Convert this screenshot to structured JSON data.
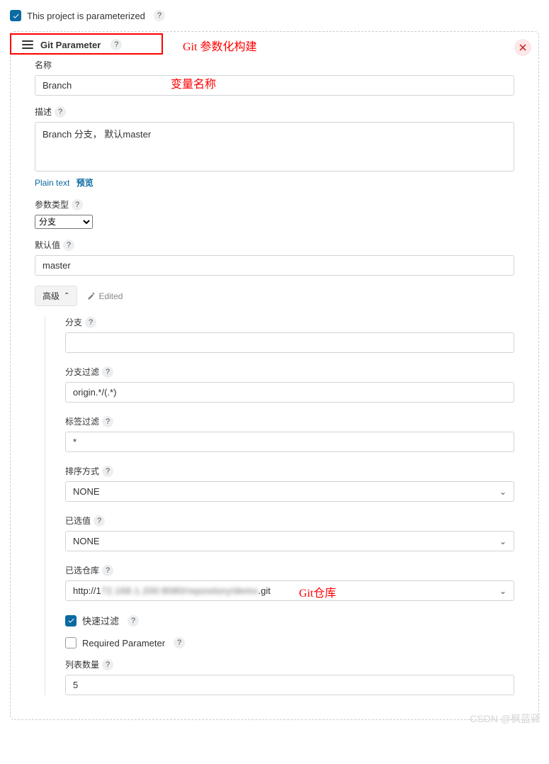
{
  "topCheckbox": {
    "label": "This project is parameterized",
    "checked": true
  },
  "panel": {
    "title": "Git Parameter",
    "annotations": {
      "header": "Git 参数化构建",
      "nameField": "变量名称",
      "repoField": "Git仓库"
    }
  },
  "fields": {
    "name": {
      "label": "名称",
      "value": "Branch"
    },
    "description": {
      "label": "描述",
      "value": "Branch 分支， 默认master",
      "formatPlain": "Plain text",
      "formatPreview": "预览"
    },
    "paramType": {
      "label": "参数类型",
      "value": "分支"
    },
    "defaultValue": {
      "label": "默认值",
      "value": "master"
    }
  },
  "advanced": {
    "buttonLabel": "高级",
    "editedLabel": "Edited",
    "branch": {
      "label": "分支",
      "value": ""
    },
    "branchFilter": {
      "label": "分支过滤",
      "value": "origin.*/(.*)"
    },
    "tagFilter": {
      "label": "标签过滤",
      "value": "*"
    },
    "sortMode": {
      "label": "排序方式",
      "value": "NONE"
    },
    "selectedValue": {
      "label": "已选值",
      "value": "NONE"
    },
    "selectedRepo": {
      "label": "已选仓库",
      "prefix": "http://1",
      "suffix": ".git",
      "obscured": "72.168.1.200:8080/repository/demo"
    },
    "quickFilter": {
      "label": "快速过滤",
      "checked": true
    },
    "requiredParam": {
      "label": "Required Parameter",
      "checked": false
    },
    "listCount": {
      "label": "列表数量",
      "value": "5"
    }
  },
  "watermark": "CSDN @枫蓝驿"
}
